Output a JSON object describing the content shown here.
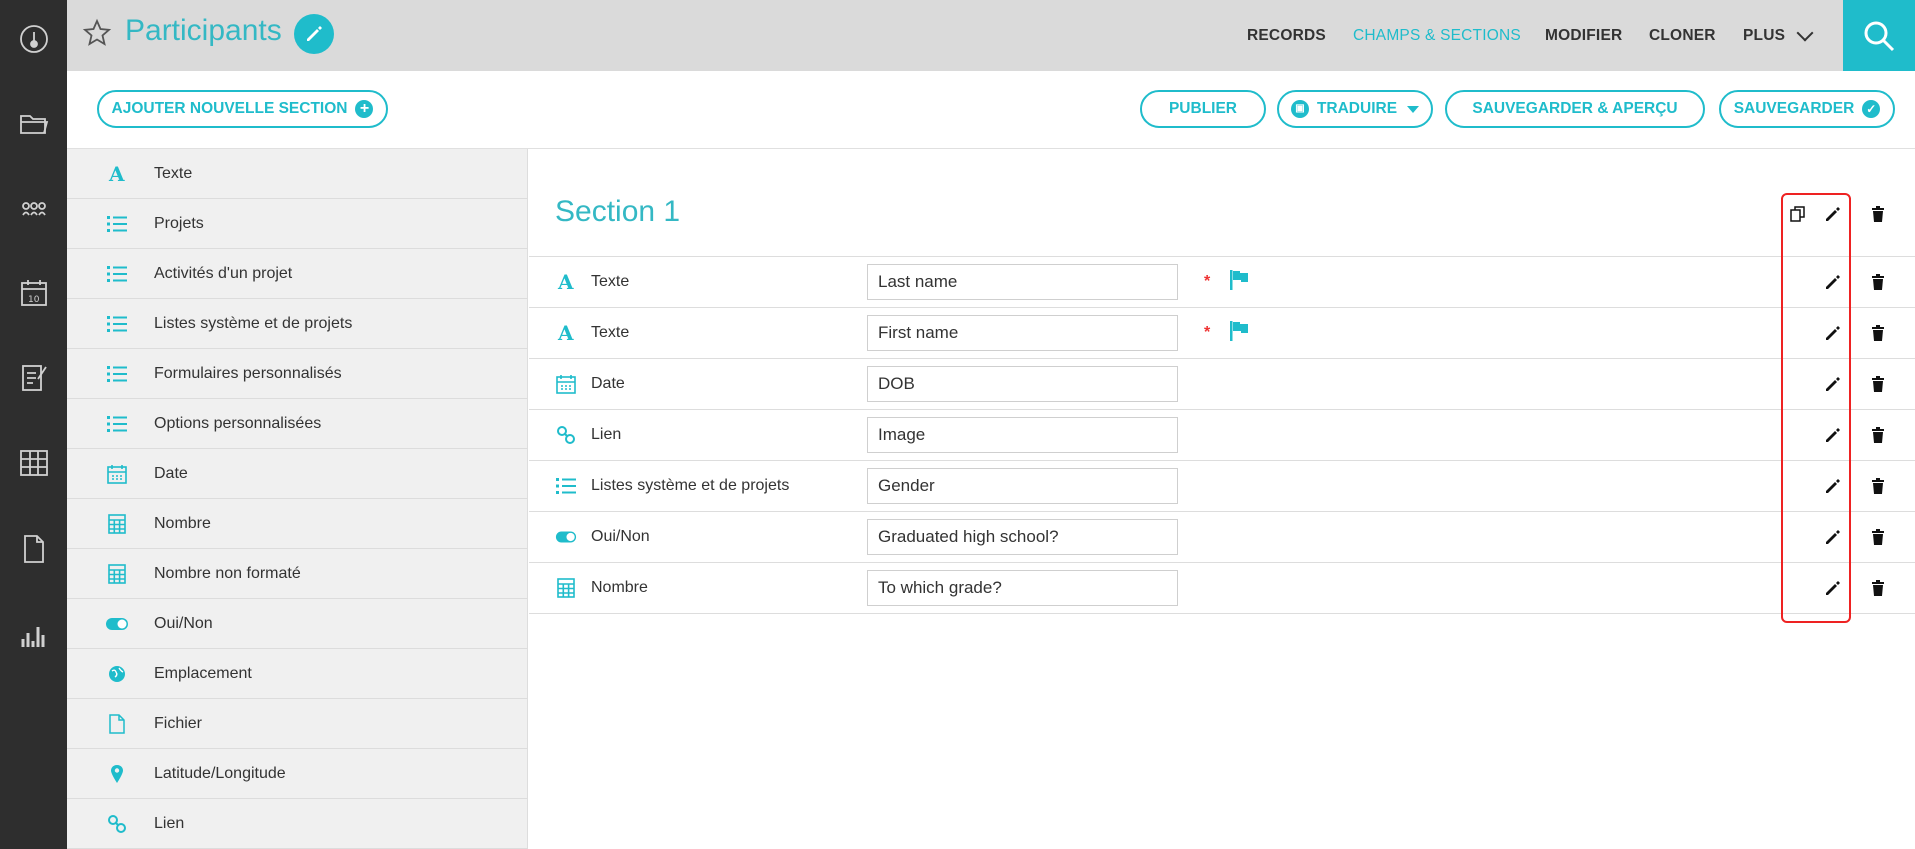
{
  "header": {
    "title": "Participants",
    "nav": [
      "RECORDS",
      "CHAMPS & SECTIONS",
      "MODIFIER",
      "CLONER",
      "PLUS"
    ]
  },
  "actions": {
    "add_section": "AJOUTER NOUVELLE SECTION",
    "publish": "PUBLIER",
    "translate": "TRADUIRE",
    "save_preview": "SAUVEGARDER & APERÇU",
    "save": "SAUVEGARDER"
  },
  "palette": [
    {
      "label": "Texte",
      "icon": "text-icon"
    },
    {
      "label": "Projets",
      "icon": "list-icon"
    },
    {
      "label": "Activités d'un projet",
      "icon": "list-icon"
    },
    {
      "label": "Listes système et de projets",
      "icon": "list-icon"
    },
    {
      "label": "Formulaires personnalisés",
      "icon": "list-icon"
    },
    {
      "label": "Options personnalisées",
      "icon": "list-icon"
    },
    {
      "label": "Date",
      "icon": "calendar-icon"
    },
    {
      "label": "Nombre",
      "icon": "calculator-icon"
    },
    {
      "label": "Nombre non formaté",
      "icon": "calculator-icon"
    },
    {
      "label": "Oui/Non",
      "icon": "toggle-icon"
    },
    {
      "label": "Emplacement",
      "icon": "globe-icon"
    },
    {
      "label": "Fichier",
      "icon": "file-icon"
    },
    {
      "label": "Latitude/Longitude",
      "icon": "pin-icon"
    },
    {
      "label": "Lien",
      "icon": "link-icon"
    }
  ],
  "section": {
    "title": "Section 1",
    "fields": [
      {
        "type": "Texte",
        "icon": "text-icon",
        "name": "Last name",
        "required": "*"
      },
      {
        "type": "Texte",
        "icon": "text-icon",
        "name": "First name",
        "required": "*"
      },
      {
        "type": "Date",
        "icon": "calendar-icon",
        "name": "DOB"
      },
      {
        "type": "Lien",
        "icon": "link-icon",
        "name": "Image"
      },
      {
        "type": "Listes système et de projets",
        "icon": "list-icon",
        "name": "Gender"
      },
      {
        "type": "Oui/Non",
        "icon": "toggle-icon",
        "name": "Graduated high school?"
      },
      {
        "type": "Nombre",
        "icon": "calculator-icon",
        "name": "To which grade?"
      }
    ]
  },
  "colors": {
    "accent": "#1fbccb",
    "sidebar": "#2e2e2e",
    "topbar": "#dadada",
    "highlight": "#e22222"
  }
}
